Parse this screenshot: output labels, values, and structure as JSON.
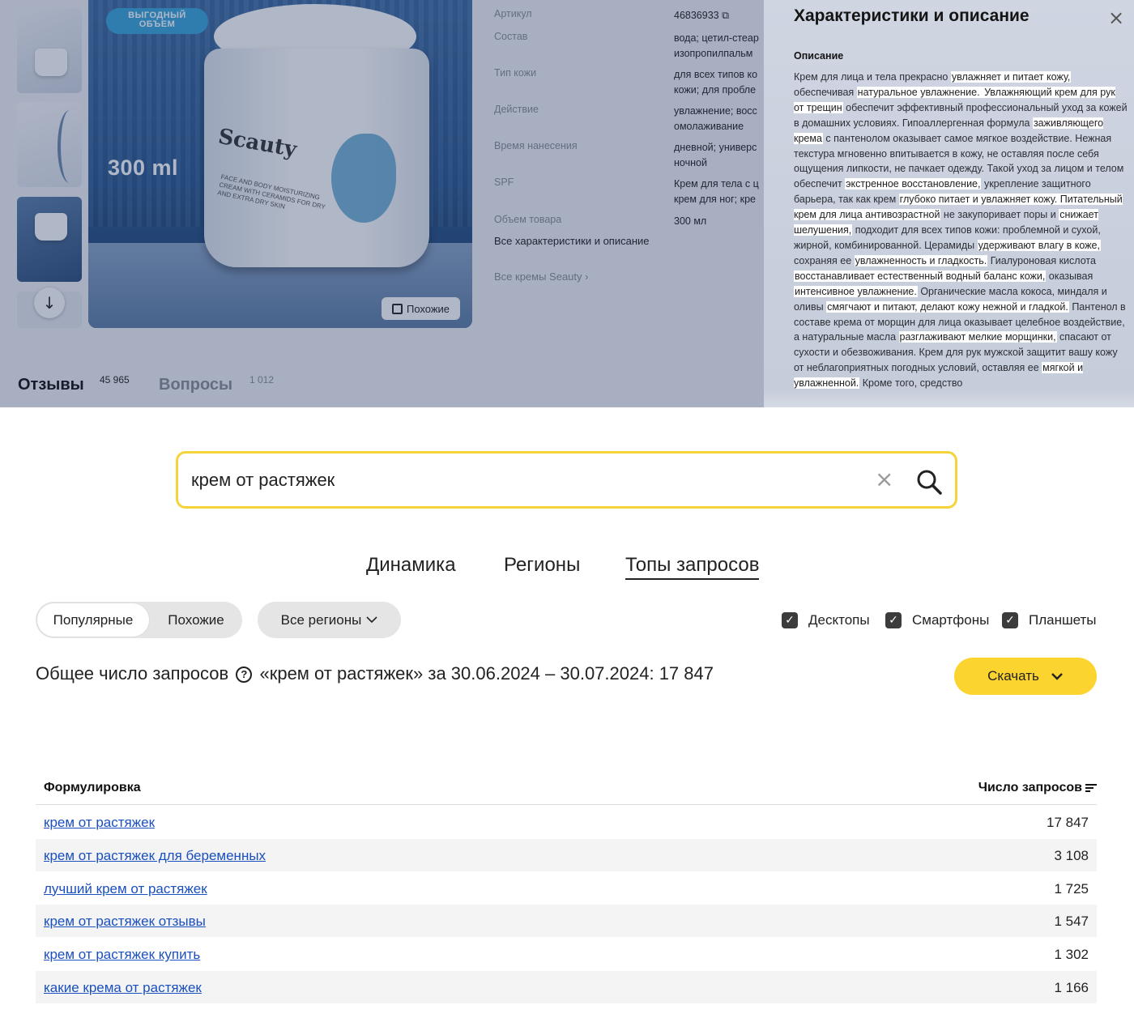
{
  "product": {
    "badge_line1": "ВЫГОДНЫЙ",
    "badge_line2": "ОБЪЕМ",
    "volume_label": "300 ml",
    "brand_on_jar": "Scauty",
    "jar_small_text": "FACE AND BODY MOISTURIZING CREAM WITH CERAMIDS FOR DRY AND EXTRA DRY SKIN",
    "similar_label": "Похожие",
    "specs": [
      {
        "label": "Артикул",
        "value": "46836933 ⧉"
      },
      {
        "label": "Состав",
        "value": "вода; цетил-стеар\nизопропилпальм"
      },
      {
        "label": "Тип кожи",
        "value": "для всех типов ко\nкожи; для пробле"
      },
      {
        "label": "Действие",
        "value": "увлажнение; восс\nомолаживание"
      },
      {
        "label": "Время нанесения",
        "value": "дневной; универс\nночной"
      },
      {
        "label": "SPF",
        "value": "Крем для тела с ц\nкрем для ног; кре"
      },
      {
        "label": "Объем товара",
        "value": "300 мл"
      }
    ],
    "all_characteristics_link": "Все характеристики и описание",
    "all_brand_link": "Все кремы Seauty  ›",
    "reviews_label": "Отзывы",
    "reviews_count": "45 965",
    "questions_label": "Вопросы",
    "questions_count": "1 012"
  },
  "panel": {
    "title": "Характеристики и описание",
    "close_icon": "×",
    "description_heading": "Описание",
    "description_segments": [
      {
        "t": "Крем для лица и тела прекрасно ",
        "h": false
      },
      {
        "t": "увлажняет и питает кожу,",
        "h": true
      },
      {
        "t": " обеспечивая ",
        "h": false
      },
      {
        "t": "натуральное увлажнение.",
        "h": true
      },
      {
        "t": " Увлажняющий крем для рук от трещин",
        "h": true
      },
      {
        "t": " обеспечит эффективный профессиональный уход за кожей в домашних условиях. Гипоаллергенная формула ",
        "h": false
      },
      {
        "t": "заживляющего крема",
        "h": true
      },
      {
        "t": " с пантенолом оказывает самое мягкое воздействие. Нежная текстура мгновенно впитывается в кожу, не оставляя после себя ощущения липкости, не пачкает одежду. Такой уход за лицом и телом обеспечит ",
        "h": false
      },
      {
        "t": "экстренное восстановление,",
        "h": true
      },
      {
        "t": " укрепление защитного барьера, так как крем ",
        "h": false
      },
      {
        "t": "глубоко питает и увлажняет кожу. Питательный крем для лица антивозрастной",
        "h": true
      },
      {
        "t": " не закупоривает поры и ",
        "h": false
      },
      {
        "t": "снижает шелушения,",
        "h": true
      },
      {
        "t": " подходит для всех типов кожи: проблемной и сухой, жирной, комбинированной. Церамиды ",
        "h": false
      },
      {
        "t": "удерживают влагу в коже,",
        "h": true
      },
      {
        "t": " сохраняя ее ",
        "h": false
      },
      {
        "t": "увлажненность и гладкость.",
        "h": true
      },
      {
        "t": " Гиалуроновая кислота ",
        "h": false
      },
      {
        "t": "восстанавливает естественный водный баланс кожи,",
        "h": true
      },
      {
        "t": " оказывая ",
        "h": false
      },
      {
        "t": "интенсивное увлажнение.",
        "h": true
      },
      {
        "t": " Органические масла кокоса, миндаля и оливы ",
        "h": false
      },
      {
        "t": "смягчают и питают, делают кожу нежной и гладкой.",
        "h": true
      },
      {
        "t": " Пантенол в составе крема от морщин для лица оказывает целебное воздействие, а натуральные масла ",
        "h": false
      },
      {
        "t": "разглаживают мелкие морщинки,",
        "h": true
      },
      {
        "t": " спасают от сухости и обезвоживания. Крем для рук мужской защитит вашу кожу от неблагоприятных погодных условий, оставляя ее ",
        "h": false
      },
      {
        "t": "мягкой и увлажненной.",
        "h": true
      },
      {
        "t": " Кроме того, средство",
        "h": false
      }
    ]
  },
  "search": {
    "query": "крем от растяжек",
    "clear_icon": "×",
    "search_icon": "magnifier-icon"
  },
  "tabs": [
    "Динамика",
    "Регионы",
    "Топы запросов"
  ],
  "filters": {
    "popular": "Популярные",
    "similar": "Похожие",
    "regions": "Все регионы",
    "devices": [
      "Десктопы",
      "Смартфоны",
      "Планшеты"
    ],
    "check_mark": "✓"
  },
  "summary": {
    "prefix": "Общее число запросов",
    "help_icon": "?",
    "rest": "«крем от растяжек» за 30.06.2024 – 30.07.2024: 17 847"
  },
  "download_label": "Скачать",
  "table": {
    "col1": "Формулировка",
    "col2": "Число запросов",
    "rows": [
      {
        "q": "крем от растяжек",
        "n": "17 847"
      },
      {
        "q": "крем от растяжек для беременных",
        "n": "3 108"
      },
      {
        "q": "лучший крем от растяжек",
        "n": "1 725"
      },
      {
        "q": "крем от растяжек отзывы",
        "n": "1 547"
      },
      {
        "q": "крем от растяжек купить",
        "n": "1 302"
      },
      {
        "q": "какие крема от растяжек",
        "n": "1 166"
      }
    ]
  },
  "colors": {
    "accent": "#fcd42f",
    "link": "#1a4fbf",
    "search_border": "#f5d33a"
  }
}
